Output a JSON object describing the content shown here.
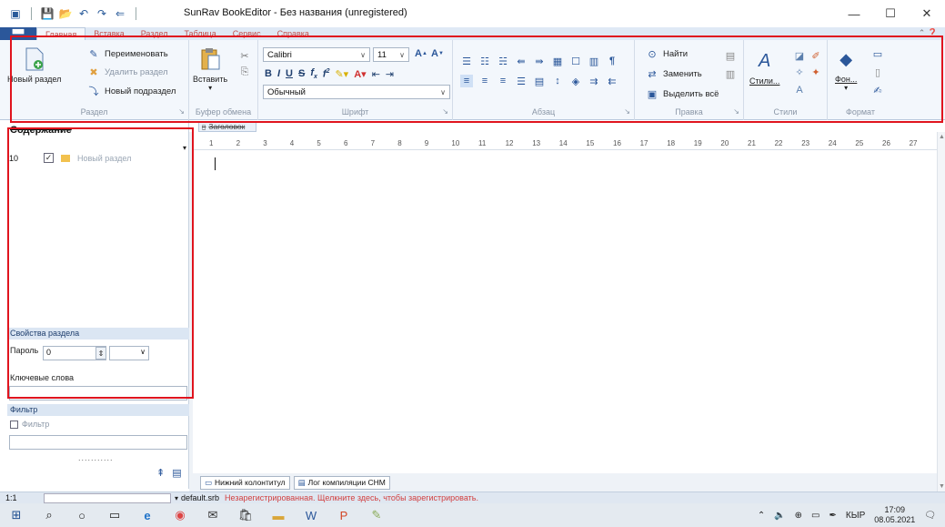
{
  "window": {
    "title": "SunRav BookEditor - Без названия (unregistered)",
    "minimize": "—",
    "maximize": "☐",
    "close": "✕"
  },
  "ribbon_tabs": {
    "file": "",
    "items": [
      "Главная",
      "Вставка",
      "Раздел",
      "Таблица",
      "Сервис",
      "Справка"
    ]
  },
  "ribbon": {
    "section_group": {
      "new_section": "Новый раздел",
      "rename": "Переименовать",
      "delete_section": "Удалить раздел",
      "new_subsection": "Новый подраздел",
      "label": "Раздел"
    },
    "clipboard_group": {
      "paste": "Вставить",
      "label": "Буфер обмена"
    },
    "font_group": {
      "font_name": "Calibri",
      "font_size": "11",
      "style": "Обычный",
      "label": "Шрифт"
    },
    "paragraph_group": {
      "label": "Абзац"
    },
    "edit_group": {
      "find": "Найти",
      "replace": "Заменить",
      "select_all": "Выделить всё",
      "label": "Правка"
    },
    "styles_group": {
      "styles": "Стили...",
      "label": "Стили"
    },
    "format_group": {
      "background": "Фон...",
      "label": "Формат"
    }
  },
  "left_panel": {
    "contents_title": "Содержание",
    "tree": [
      {
        "num": "10",
        "label": "Новый раздел"
      }
    ],
    "properties_title": "Свойства раздела",
    "password_label": "Пароль",
    "password_value": "0",
    "keywords_label": "Ключевые слова",
    "filter_title": "Фильтр",
    "filter_check_label": "Фильтр",
    "dots": "..........."
  },
  "editor": {
    "tab_label": "Заголовок",
    "ruler_ticks": [
      "1",
      "2",
      "3",
      "4",
      "5",
      "6",
      "7",
      "8",
      "9",
      "10",
      "11",
      "12",
      "13",
      "14",
      "15",
      "16",
      "17",
      "18",
      "19",
      "20",
      "21",
      "22",
      "23",
      "24",
      "25",
      "26",
      "27"
    ]
  },
  "bottom_tabs": [
    "Нижний колонтитул",
    "Лог компиляции CHM"
  ],
  "status": {
    "position": "1:1",
    "file": "default.srb",
    "message": "Незарегистрированная. Щелкните здесь, чтобы зарегистрировать."
  },
  "taskbar": {
    "lang": "КЫР",
    "time": "17:09",
    "date": "08.05.2021"
  },
  "colors": {
    "highlight": "#e0141e",
    "accent": "#2b579a",
    "status_message": "#d24040"
  }
}
